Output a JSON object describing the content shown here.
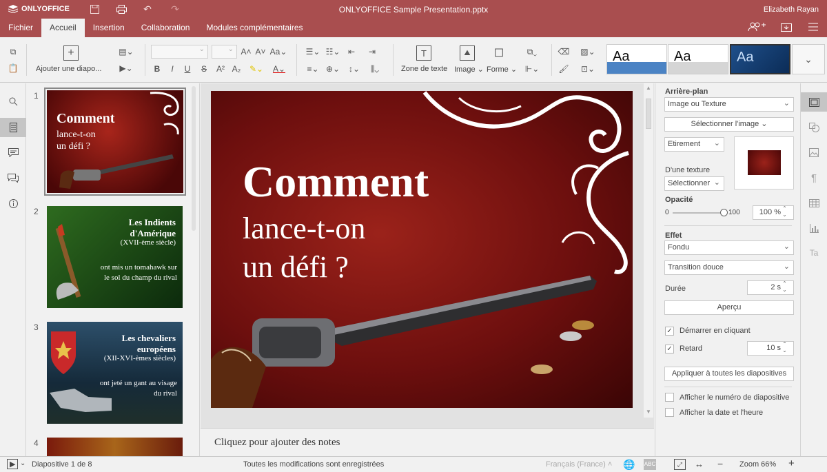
{
  "app": {
    "logo": "ONLYOFFICE",
    "title": "ONLYOFFICE Sample Presentation.pptx",
    "user": "Elizabeth Rayan"
  },
  "tabs": [
    {
      "label": "Fichier"
    },
    {
      "label": "Accueil"
    },
    {
      "label": "Insertion"
    },
    {
      "label": "Collaboration"
    },
    {
      "label": "Modules complémentaires"
    }
  ],
  "toolbar": {
    "add_slide": "Ajouter une diapo...",
    "text_box": "Zone de texte",
    "image": "Image",
    "shape": "Forme",
    "theme_sample": "Aa"
  },
  "slides": [
    {
      "num": "1",
      "title": "Comment",
      "subtitle": "lance-t-on\nun défi ?"
    },
    {
      "num": "2",
      "title": "Les Indients d'Amérique",
      "era": "(XVII-ème siècle)",
      "caption": "ont mis un tomahawk sur le sol du champ du rival"
    },
    {
      "num": "3",
      "title": "Les chevaliers européens",
      "era": "(XII-XVI-èmes siècles)",
      "caption": "ont jeté un gant au visage du rival"
    },
    {
      "num": "4"
    }
  ],
  "main_slide": {
    "title": "Comment",
    "line1": "lance-t-on",
    "line2": "un défi ?"
  },
  "notes_placeholder": "Cliquez pour ajouter des notes",
  "panel": {
    "background_label": "Arrière-plan",
    "fill_type": "Image ou Texture",
    "select_image": "Sélectionner l'image",
    "stretch": "Etirement",
    "texture_label": "D'une texture",
    "texture_select": "Sélectionner",
    "opacity_label": "Opacité",
    "opacity_min": "0",
    "opacity_max": "100",
    "opacity_value": "100 %",
    "opacity_fraction": 1.0,
    "effect_label": "Effet",
    "effect": "Fondu",
    "transition": "Transition douce",
    "duration_label": "Durée",
    "duration": "2 s",
    "preview": "Aperçu",
    "start_on_click": "Démarrer en cliquant",
    "start_on_click_checked": true,
    "delay_label": "Retard",
    "delay_checked": true,
    "delay": "10 s",
    "apply_all": "Appliquer à toutes les diapositives",
    "show_slide_number": "Afficher le numéro de diapositive",
    "show_date": "Afficher la date et l'heure"
  },
  "status": {
    "slide_indicator": "Diapositive 1 de 8",
    "saved": "Toutes les modifications sont enregistrées",
    "language": "Français (France)",
    "zoom": "Zoom 66%"
  },
  "colors": {
    "brand": "#a94e4f",
    "slide_red": "#7d1414",
    "panel_bg": "#f1f1f1"
  }
}
